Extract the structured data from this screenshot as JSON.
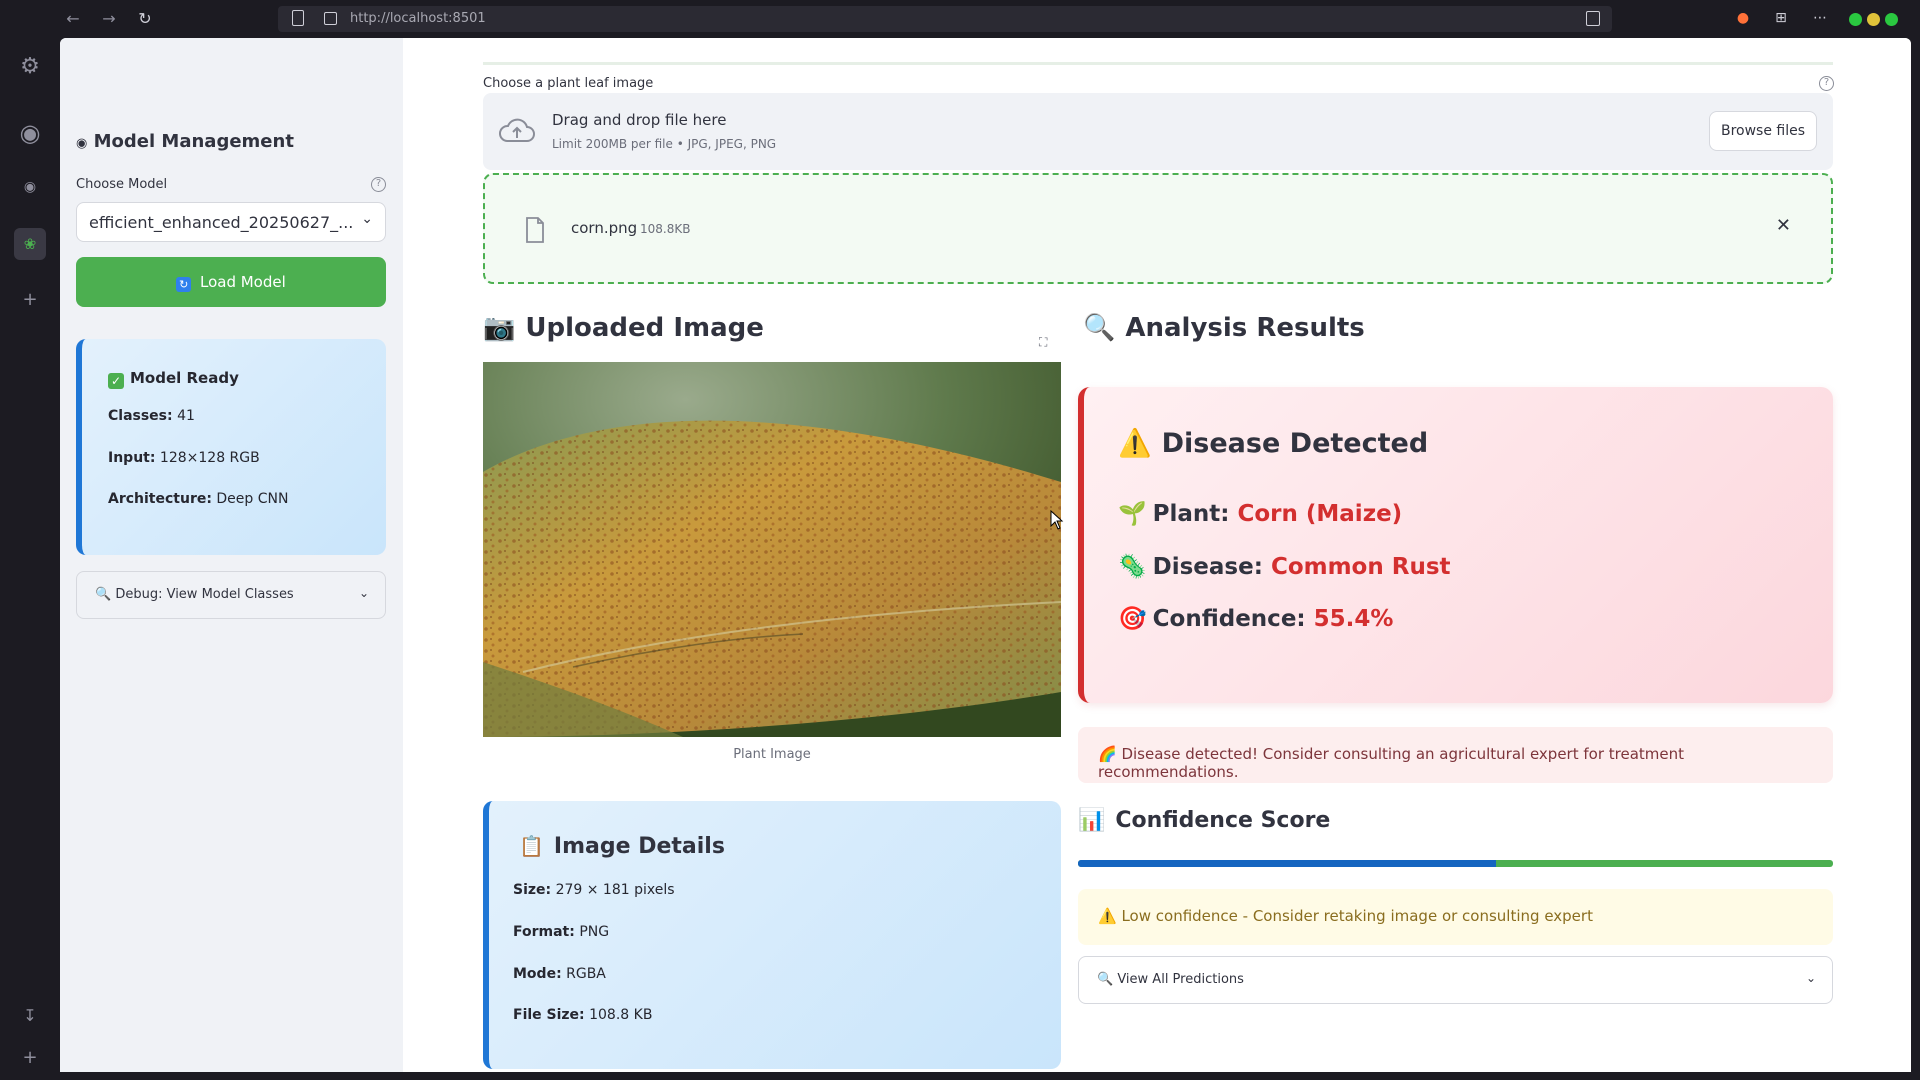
{
  "browser": {
    "url": "http://localhost:8501"
  },
  "sidebar": {
    "title": "Model Management",
    "choose_model_label": "Choose Model",
    "selected_model": "efficient_enhanced_20250627_...",
    "load_button": "Load Model",
    "model_status": {
      "title": "Model Ready",
      "classes_label": "Classes:",
      "classes_value": "41",
      "input_label": "Input:",
      "input_value": "128×128 RGB",
      "architecture_label": "Architecture:",
      "architecture_value": "Deep CNN"
    },
    "debug_expander": "Debug: View Model Classes"
  },
  "uploader": {
    "label": "Choose a plant leaf image",
    "drop_text": "Drag and drop file here",
    "limit_text": "Limit 200MB per file • JPG, JPEG, PNG",
    "browse_button": "Browse files",
    "file_name": "corn.png",
    "file_size": "108.8KB"
  },
  "uploaded_image": {
    "heading": "Uploaded Image",
    "caption": "Plant Image"
  },
  "image_details": {
    "heading": "Image Details",
    "size_label": "Size:",
    "size_value": "279 × 181 pixels",
    "format_label": "Format:",
    "format_value": "PNG",
    "mode_label": "Mode:",
    "mode_value": "RGBA",
    "filesize_label": "File Size:",
    "filesize_value": "108.8 KB"
  },
  "analysis": {
    "heading": "Analysis Results",
    "card_title": "Disease Detected",
    "plant_label": "Plant:",
    "plant_value": "Corn (Maize)",
    "disease_label": "Disease:",
    "disease_value": "Common Rust",
    "confidence_label": "Confidence:",
    "confidence_value": "55.4%",
    "alert": "Disease detected! Consider consulting an agricultural expert for treatment recommendations."
  },
  "confidence_score": {
    "heading": "Confidence Score",
    "progress": 0.554,
    "low_confidence_msg": "Low confidence - Consider retaking image or consulting expert",
    "predictions_expander": "View All Predictions"
  },
  "colors": {
    "primary_green": "#4caf50",
    "info_blue": "#1f77d6",
    "danger_red": "#d32f2f",
    "progress_blue": "#1565c0"
  }
}
